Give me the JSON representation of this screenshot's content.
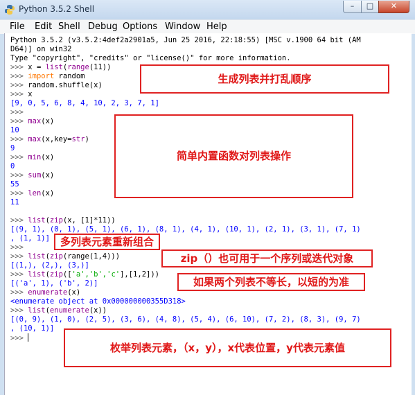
{
  "window": {
    "title": "Python 3.5.2 Shell"
  },
  "titlebar": {
    "minimize": "–",
    "maximize": "□",
    "close": "✕"
  },
  "menu": [
    "File",
    "Edit",
    "Shell",
    "Debug",
    "Options",
    "Window",
    "Help"
  ],
  "shell": {
    "banner1": "Python 3.5.2 (v3.5.2:4def2a2901a5, Jun 25 2016, 22:18:55) [MSC v.1900 64 bit (AM",
    "banner2": "D64)] on win32",
    "banner3": "Type \"copyright\", \"credits\" or \"license()\" for more information.",
    "prompt": ">>> ",
    "l_x_eq": "x = ",
    "l_list": "list",
    "l_paren": "(",
    "l_range": "range",
    "l_11": "(11))",
    "l_import": "import",
    "l_random": " random",
    "l_shuffle": "random.shuffle(x)",
    "l_x": "x",
    "o_shuffled": "[9, 0, 5, 6, 8, 4, 10, 2, 3, 7, 1]",
    "l_max": "max",
    "l_max_args": "(x)",
    "o_max": "10",
    "l_max_key": "(x,key=",
    "l_str": "str",
    "l_close": ")",
    "o_max_key": "9",
    "l_min": "min",
    "o_min": "0",
    "l_sum": "sum",
    "o_sum": "55",
    "l_len": "len",
    "o_len": "11",
    "l_zip": "zip",
    "l_zip1_args": "(x, [1]*11))",
    "o_zip1a": "[(9, 1), (0, 1), (5, 1), (6, 1), (8, 1), (4, 1), (10, 1), (2, 1), (3, 1), (7, 1)",
    "o_zip1b": ", (1, 1)]",
    "l_zip2_args": "(range(1,4)))",
    "o_zip2": "[(1,), (2,), (3,)]",
    "l_zip3_pre": "([",
    "l_zip3_strs": "'a','b','c'",
    "l_zip3_post": "],[1,2]))",
    "o_zip3": "[('a', 1), ('b', 2)]",
    "l_enum": "enumerate",
    "o_enum": "<enumerate object at 0x000000000355D318>",
    "l_enum_args": "(x))",
    "o_enum_a": "[(0, 9), (1, 0), (2, 5), (3, 6), (4, 8), (5, 4), (6, 10), (7, 2), (8, 3), (9, 7)",
    "o_enum_b": ", (10, 1)]"
  },
  "annotations": {
    "shuffle": "生成列表并打乱顺序",
    "builtins": "简单内置函数对列表操作",
    "zip_multi": "多列表元素重新组合",
    "zip_single": "zip（）也可用于一个序列或迭代对象",
    "zip_unequal": "如果两个列表不等长，以短的为准",
    "enumerate": "枚举列表元素，（x，y），x代表位置，y代表元素值"
  },
  "colors": {
    "annotation_border": "#e02222",
    "output": "#0000ff",
    "keyword": "#ff7700",
    "builtin": "#900090",
    "string": "#00aa00"
  }
}
